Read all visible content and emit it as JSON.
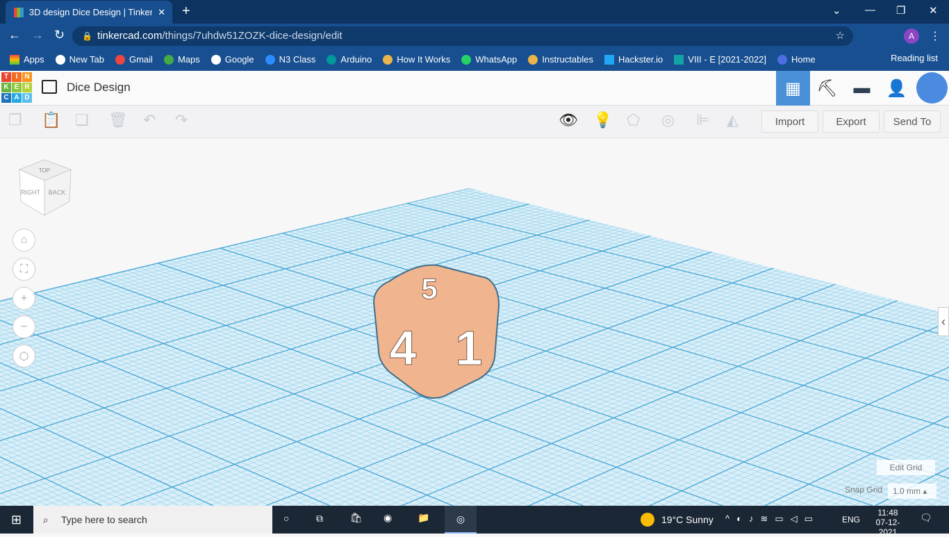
{
  "browser": {
    "tab_title": "3D design Dice Design | Tinkercad",
    "url_host": "tinkercad.com",
    "url_path": "/things/7uhdw51ZOZK-dice-design/edit",
    "profile_initial": "A",
    "bookmarks": [
      "Apps",
      "New Tab",
      "Gmail",
      "Maps",
      "Google",
      "N3 Class",
      "Arduino",
      "How It Works",
      "WhatsApp",
      "Instructables",
      "Hackster.io",
      "VIII - E [2021-2022]",
      "Home"
    ],
    "reading_list": "Reading list"
  },
  "app": {
    "logo_letters": [
      "T",
      "I",
      "N",
      "K",
      "E",
      "R",
      "C",
      "A",
      "D"
    ],
    "design_title": "Dice Design",
    "import": "Import",
    "export": "Export",
    "send_to": "Send To",
    "viewcube": {
      "top": "TOP",
      "right": "RIGHT",
      "back": "BACK"
    },
    "edit_grid": "Edit Grid",
    "snap_grid_label": "Snap Grid",
    "snap_grid_value": "1.0 mm",
    "dice_faces": [
      "5",
      "4",
      "1"
    ],
    "accent": "#4a90d9",
    "dice_color": "#f0b58e"
  },
  "taskbar": {
    "search_placeholder": "Type here to search",
    "weather": "19°C  Sunny",
    "lang": "ENG",
    "time": "11:48",
    "date": "07-12-2021"
  }
}
